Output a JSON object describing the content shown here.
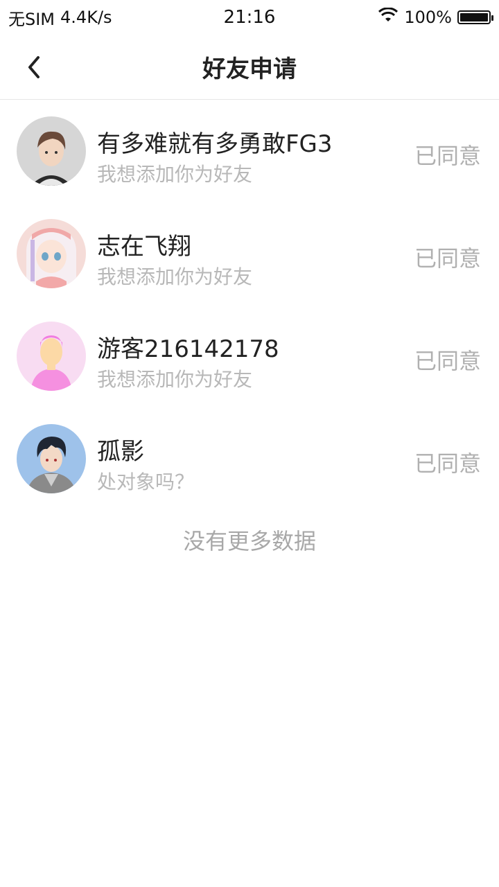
{
  "status_bar": {
    "carrier": "无SIM",
    "speed": "4.4K/s",
    "time": "21:16",
    "battery": "100%"
  },
  "header": {
    "title": "好友申请"
  },
  "requests": [
    {
      "name": "有多难就有多勇敢FG3",
      "message": "我想添加你为好友",
      "status": "已同意"
    },
    {
      "name": "志在飞翔",
      "message": "我想添加你为好友",
      "status": "已同意"
    },
    {
      "name": "游客216142178",
      "message": "我想添加你为好友",
      "status": "已同意"
    },
    {
      "name": "孤影",
      "message": "处对象吗？",
      "status": "已同意"
    }
  ],
  "footer": {
    "no_more": "没有更多数据"
  }
}
